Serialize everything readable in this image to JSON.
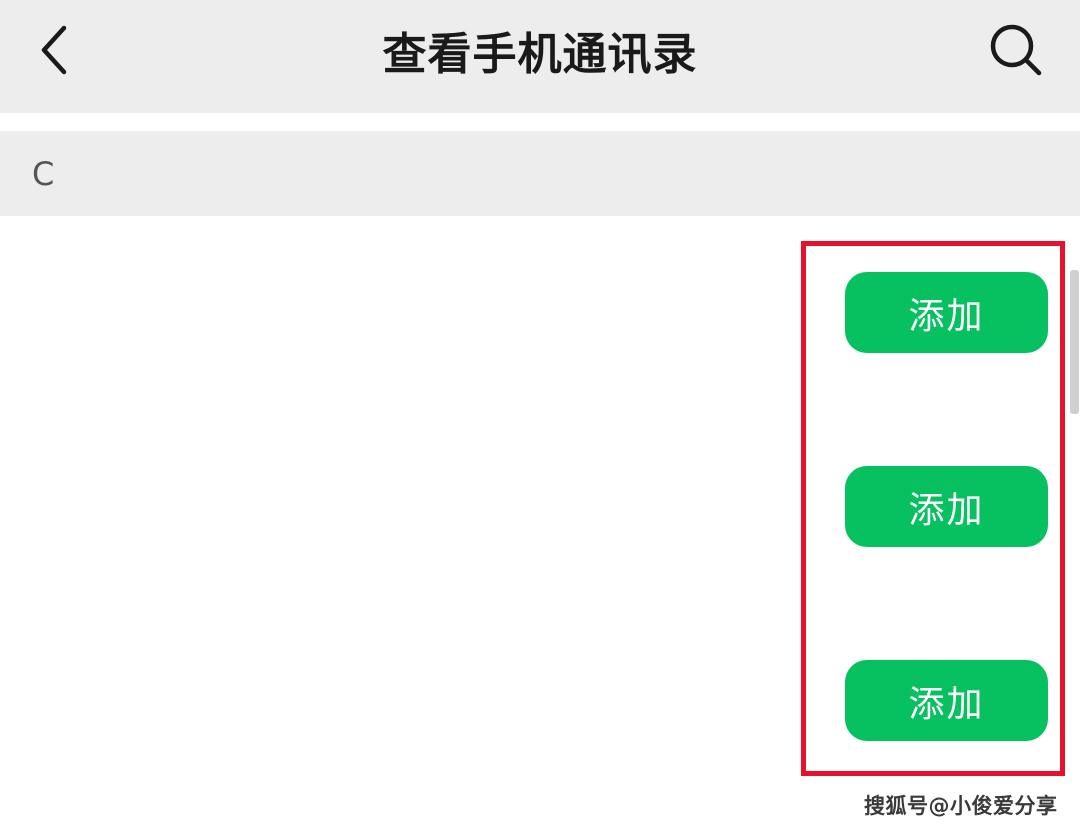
{
  "header": {
    "title": "查看手机通讯录",
    "back_icon": "chevron-left-icon",
    "search_icon": "search-icon"
  },
  "section": {
    "letter": "C"
  },
  "contacts": [
    {
      "add_label": "添加"
    },
    {
      "add_label": "添加"
    },
    {
      "add_label": "添加"
    }
  ],
  "colors": {
    "header_bg": "#ededed",
    "accent_green": "#07c160",
    "highlight_red": "#e8102a"
  },
  "watermark": "搜狐号@小俊爱分享"
}
